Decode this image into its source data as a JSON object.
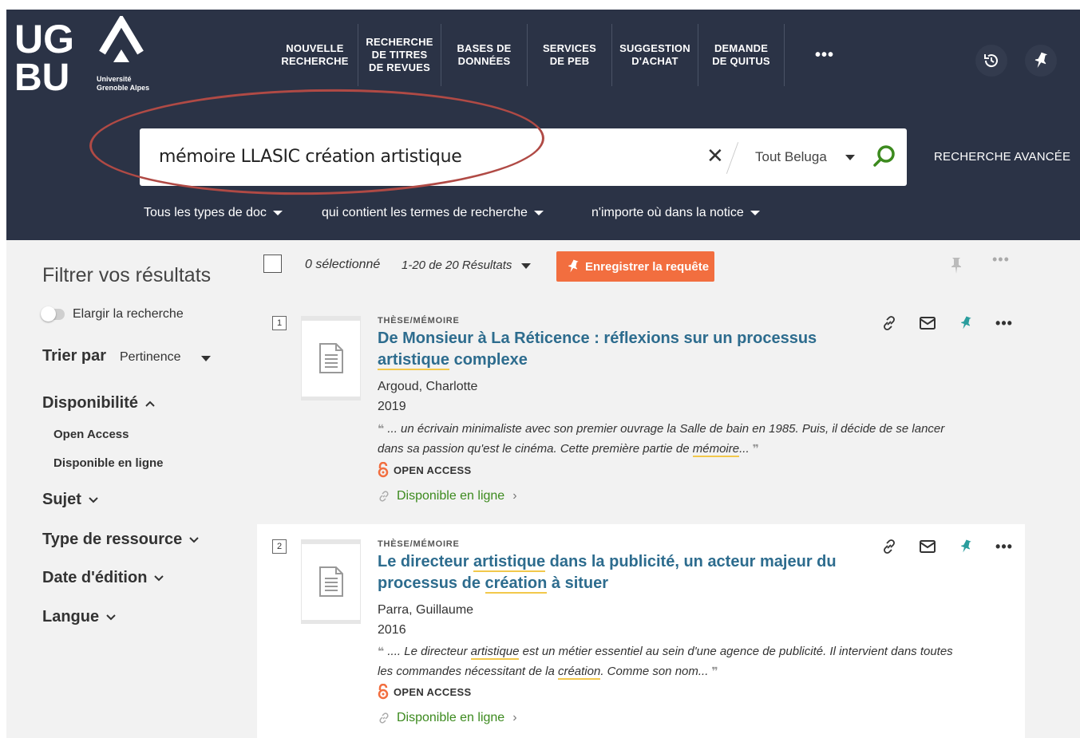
{
  "logo": {
    "main": "UGA BU",
    "sub_1": "Université",
    "sub_2": "Grenoble Alpes"
  },
  "nav": {
    "items": [
      {
        "label": "NOUVELLE\nRECHERCHE"
      },
      {
        "label": "RECHERCHE\nDE TITRES\nDE REVUES"
      },
      {
        "label": "BASES DE\nDONNÉES"
      },
      {
        "label": "SERVICES\nDE PEB"
      },
      {
        "label": "SUGGESTION\nD'ACHAT"
      },
      {
        "label": "DEMANDE\nDE QUITUS"
      }
    ],
    "more": "•••"
  },
  "search": {
    "query": "mémoire LLASIC création artistique",
    "scope": "Tout Beluga",
    "advanced": "RECHERCHE AVANCÉE",
    "filters": [
      "Tous les types de doc",
      "qui contient les termes de recherche",
      "n'importe où dans la notice"
    ]
  },
  "sidebar": {
    "title": "Filtrer vos résultats",
    "expand_label": "Elargir la recherche",
    "sort_label": "Trier par",
    "sort_value": "Pertinence",
    "facets": {
      "availability": "Disponibilité",
      "availability_options": [
        "Open Access",
        "Disponible en ligne"
      ],
      "subject": "Sujet",
      "resource_type": "Type de ressource",
      "edition_date": "Date d'édition",
      "language": "Langue"
    }
  },
  "results_header": {
    "selected": "0 sélectionné",
    "count": "1-20 de 20 Résultats",
    "save_query": "Enregistrer la requête",
    "more": "•••"
  },
  "results": [
    {
      "index": "1",
      "type": "THÈSE/MÉMOIRE",
      "title_parts": [
        "De Monsieur à La Réticence : réflexions sur un processus ",
        "artistique",
        " complexe"
      ],
      "author": "Argoud, Charlotte",
      "year": "2019",
      "snippet_parts": [
        " ... un écrivain minimaliste avec son premier ouvrage la Salle de bain en 1985. Puis, il décide de se lancer dans sa passion qu'est le cinéma. Cette première partie de ",
        "mémoire",
        "... "
      ],
      "open_access": "OPEN ACCESS",
      "availability": "Disponible en ligne"
    },
    {
      "index": "2",
      "type": "THÈSE/MÉMOIRE",
      "title_parts": [
        "Le directeur ",
        "artistique",
        " dans la publicité, un acteur majeur du processus de ",
        "création",
        " à situer"
      ],
      "author": "Parra, Guillaume",
      "year": "2016",
      "snippet_parts": [
        " .... Le directeur ",
        "artistique",
        " est un métier essentiel au sein d'une agence de publicité. Il intervient dans toutes les commandes nécessitant de la ",
        "création",
        ". Comme son nom... "
      ],
      "open_access": "OPEN ACCESS",
      "availability": "Disponible en ligne"
    }
  ],
  "colors": {
    "header_bg": "#2b3346",
    "link_blue": "#2d6c8e",
    "orange": "#f26e3f",
    "green": "#3c8a1e",
    "teal_pin": "#2a9d9d",
    "highlight": "#f2c84b",
    "annotation": "#b04a45"
  }
}
